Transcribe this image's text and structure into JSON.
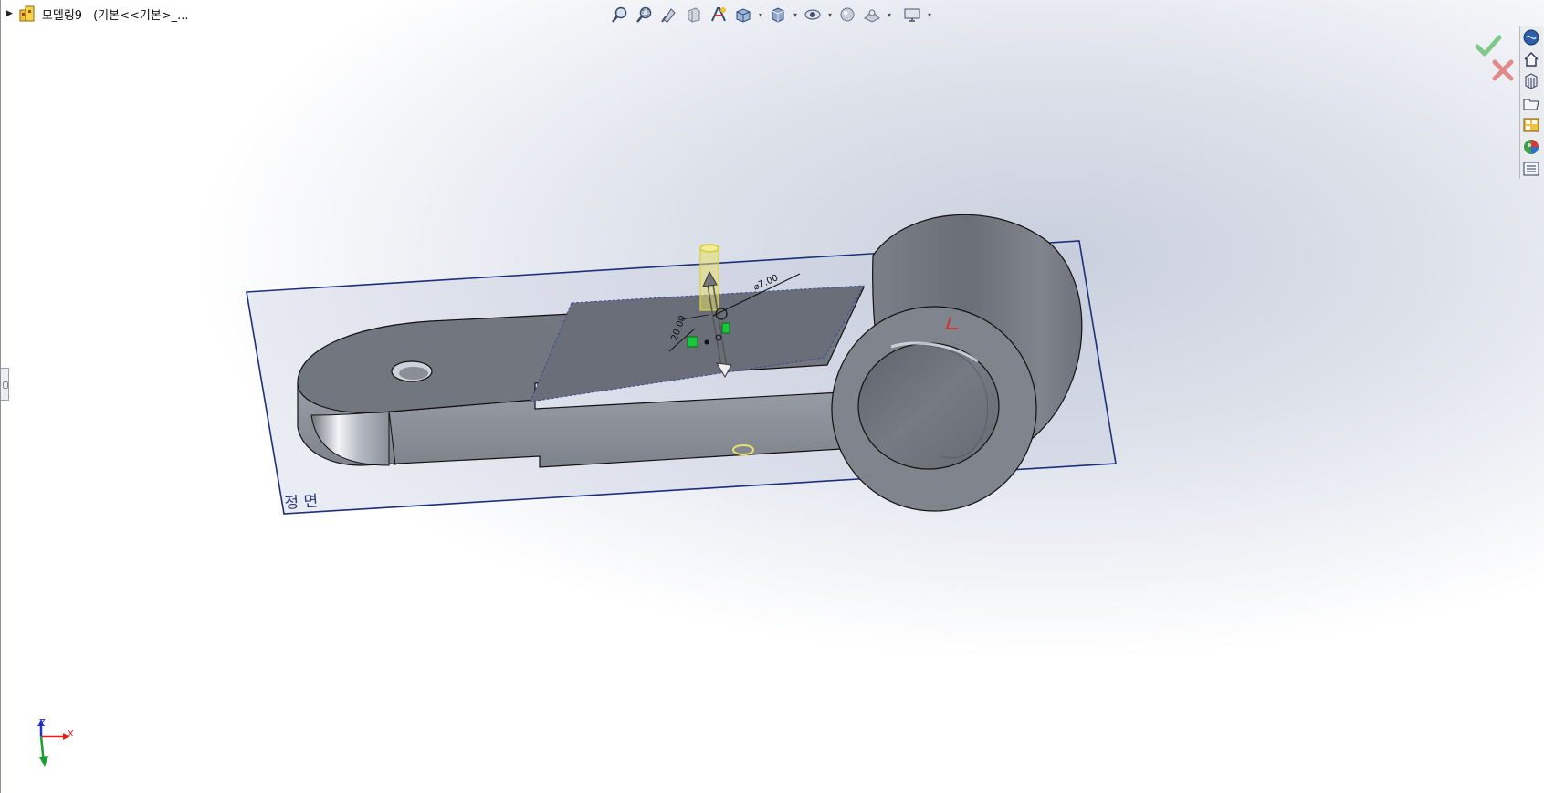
{
  "tree": {
    "model_name": "모델링9",
    "config_label": "(기본<<기본>_..."
  },
  "hud_toolbar": {
    "items": [
      {
        "icon": "zoom-to-fit-icon",
        "dropdown": false
      },
      {
        "icon": "zoom-to-area-icon",
        "dropdown": false
      },
      {
        "icon": "previous-view-icon",
        "dropdown": false
      },
      {
        "icon": "section-view-icon",
        "dropdown": false
      },
      {
        "icon": "dynamic-annotation-view-icon",
        "dropdown": false
      },
      {
        "icon": "view-orientation-icon",
        "dropdown": true
      },
      {
        "icon": "display-style-icon",
        "dropdown": true
      },
      {
        "icon": "hide-show-items-icon",
        "dropdown": true
      },
      {
        "icon": "edit-appearance-icon",
        "dropdown": false
      },
      {
        "icon": "apply-scene-icon",
        "dropdown": true
      },
      {
        "icon": "view-settings-icon",
        "dropdown": true
      }
    ]
  },
  "confirmation": {
    "accept_icon": "green-check-icon",
    "cancel_icon": "red-x-icon"
  },
  "task_pane": {
    "items": [
      "solidworks-resources-icon",
      "home-icon",
      "design-library-icon",
      "file-explorer-icon",
      "view-palette-icon",
      "appearances-icon",
      "custom-properties-icon"
    ]
  },
  "scene": {
    "plane_label": "정 면",
    "dimension_diameter": "⌀7.00",
    "dimension_length": "20.00"
  },
  "triad": {
    "x_label": "X",
    "z_label": "Z"
  },
  "colors": {
    "plane_border": "#1c2f7a",
    "part_top": "#72767f",
    "part_side": "#898d96",
    "preview_yellow": "#e8e06a",
    "relation_green": "#16c83a",
    "accept_green": "#7fc88a",
    "cancel_red": "#e08a8a"
  }
}
